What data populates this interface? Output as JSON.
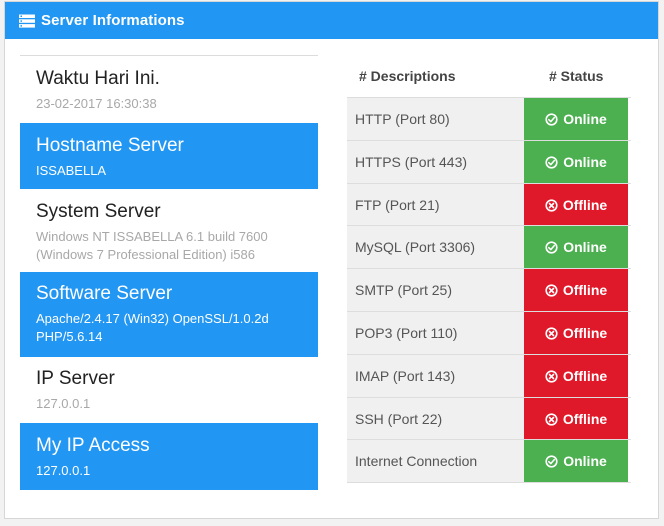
{
  "header": {
    "title": "Server Informations",
    "icon": "server-list-icon"
  },
  "info": [
    {
      "head": "Waktu Hari Ini.",
      "sub": [
        "23-02-2017 16:30:38"
      ],
      "style": "white"
    },
    {
      "head": "Hostname Server",
      "sub": [
        "ISSABELLA"
      ],
      "style": "blue"
    },
    {
      "head": "System Server",
      "sub": [
        "Windows NT ISSABELLA 6.1 build 7600",
        "(Windows 7 Professional Edition) i586"
      ],
      "style": "white"
    },
    {
      "head": "Software Server",
      "sub": [
        "Apache/2.4.17 (Win32) OpenSSL/1.0.2d",
        "PHP/5.6.14"
      ],
      "style": "blue"
    },
    {
      "head": "IP Server",
      "sub": [
        "127.0.0.1"
      ],
      "style": "white"
    },
    {
      "head": "My IP Access",
      "sub": [
        "127.0.0.1"
      ],
      "style": "blue"
    }
  ],
  "table": {
    "col_desc": "# Descriptions",
    "col_status": "# Status",
    "rows": [
      {
        "desc": "HTTP (Port 80)",
        "status": "Online",
        "state": "online"
      },
      {
        "desc": "HTTPS (Port 443)",
        "status": "Online",
        "state": "online"
      },
      {
        "desc": "FTP (Port 21)",
        "status": "Offline",
        "state": "offline"
      },
      {
        "desc": "MySQL (Port 3306)",
        "status": "Online",
        "state": "online"
      },
      {
        "desc": "SMTP (Port 25)",
        "status": "Offline",
        "state": "offline"
      },
      {
        "desc": "POP3 (Port 110)",
        "status": "Offline",
        "state": "offline"
      },
      {
        "desc": "IMAP (Port 143)",
        "status": "Offline",
        "state": "offline"
      },
      {
        "desc": "SSH (Port 22)",
        "status": "Offline",
        "state": "offline"
      },
      {
        "desc": "Internet Connection",
        "status": "Online",
        "state": "online"
      }
    ]
  },
  "colors": {
    "primary": "#2196f3",
    "online": "#4caf50",
    "offline": "#e0192a"
  }
}
